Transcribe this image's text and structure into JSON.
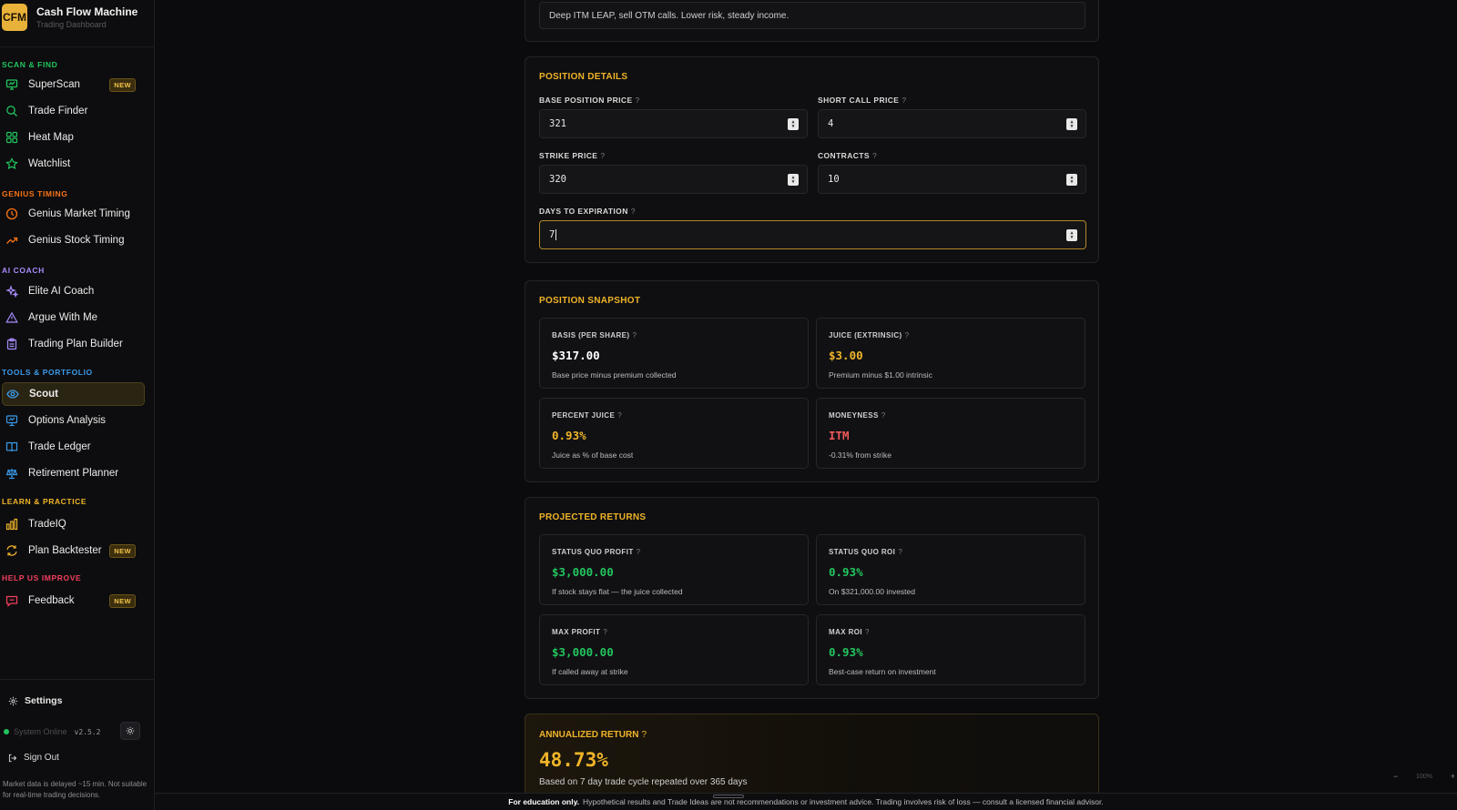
{
  "app": {
    "logo_text": "CFM",
    "title": "Cash Flow Machine",
    "subtitle": "Trading Dashboard"
  },
  "sidebar": {
    "sections": [
      {
        "label": "SCAN & FIND",
        "color": "#22c55e"
      },
      {
        "label": "GENIUS TIMING",
        "color": "#f97316"
      },
      {
        "label": "AI COACH",
        "color": "#a78bfa"
      },
      {
        "label": "TOOLS & PORTFOLIO",
        "color": "#3b9ae8"
      },
      {
        "label": "LEARN & PRACTICE",
        "color": "#f0b429"
      },
      {
        "label": "HELP US IMPROVE",
        "color": "#f43f5e"
      }
    ],
    "items": [
      {
        "label": "SuperScan",
        "icon": "monitor-icon",
        "badge": "NEW"
      },
      {
        "label": "Trade Finder",
        "icon": "search-icon"
      },
      {
        "label": "Heat Map",
        "icon": "grid-icon"
      },
      {
        "label": "Watchlist",
        "icon": "star-icon"
      },
      {
        "label": "Genius Market Timing",
        "icon": "clock-icon"
      },
      {
        "label": "Genius Stock Timing",
        "icon": "trend-up-icon"
      },
      {
        "label": "Elite AI Coach",
        "icon": "sparkles-icon"
      },
      {
        "label": "Argue With Me",
        "icon": "warning-icon"
      },
      {
        "label": "Trading Plan Builder",
        "icon": "clipboard-icon"
      },
      {
        "label": "Scout",
        "icon": "eye-icon",
        "active": true
      },
      {
        "label": "Options Analysis",
        "icon": "presentation-icon"
      },
      {
        "label": "Trade Ledger",
        "icon": "book-icon"
      },
      {
        "label": "Retirement Planner",
        "icon": "scale-icon"
      },
      {
        "label": "TradeIQ",
        "icon": "bar-chart-icon"
      },
      {
        "label": "Plan Backtester",
        "icon": "refresh-icon",
        "badge": "NEW"
      },
      {
        "label": "Feedback",
        "icon": "message-icon",
        "badge": "NEW"
      }
    ],
    "settings_label": "Settings",
    "status_text": "System Online",
    "version": "v2.5.2",
    "signout_label": "Sign Out",
    "disclaimer": "Market data is delayed ~15 min. Not suitable for real-time trading decisions."
  },
  "strategy": {
    "description": "Deep ITM LEAP, sell OTM calls. Lower risk, steady income."
  },
  "position_details": {
    "title": "POSITION DETAILS",
    "base_price": {
      "label": "BASE POSITION PRICE",
      "value": "321"
    },
    "short_call": {
      "label": "SHORT CALL PRICE",
      "value": "4"
    },
    "strike": {
      "label": "STRIKE PRICE",
      "value": "320"
    },
    "contracts": {
      "label": "CONTRACTS",
      "value": "10"
    },
    "dte": {
      "label": "DAYS TO EXPIRATION",
      "value": "7"
    }
  },
  "snapshot": {
    "title": "POSITION SNAPSHOT",
    "basis": {
      "label": "BASIS (PER SHARE)",
      "value": "$317.00",
      "desc": "Base price minus premium collected"
    },
    "juice": {
      "label": "JUICE (EXTRINSIC)",
      "value": "$3.00",
      "desc": "Premium minus $1.00 intrinsic"
    },
    "pct_juice": {
      "label": "PERCENT JUICE",
      "value": "0.93%",
      "desc": "Juice as % of base cost"
    },
    "moneyness": {
      "label": "MONEYNESS",
      "value": "ITM",
      "desc": "-0.31% from strike"
    }
  },
  "returns": {
    "title": "PROJECTED RETURNS",
    "sq_profit": {
      "label": "STATUS QUO PROFIT",
      "value": "$3,000.00",
      "desc": "If stock stays flat — the juice collected"
    },
    "sq_roi": {
      "label": "STATUS QUO ROI",
      "value": "0.93%",
      "desc": "On $321,000.00 invested"
    },
    "max_profit": {
      "label": "MAX PROFIT",
      "value": "$3,000.00",
      "desc": "If called away at strike"
    },
    "max_roi": {
      "label": "MAX ROI",
      "value": "0.93%",
      "desc": "Best-case return on investment"
    }
  },
  "annualized": {
    "title": "ANNUALIZED RETURN",
    "value": "48.73%",
    "desc": "Based on 7 day trade cycle repeated over 365 days"
  },
  "footer": {
    "bold": "For education only.",
    "text": "Hypothetical results and Trade Ideas are not recommendations or investment advice. Trading involves risk of loss — consult a licensed financial advisor."
  },
  "zoom": {
    "minus": "−",
    "value": "100%",
    "plus": "+"
  },
  "help_glyph": "?",
  "colors": {
    "accent": "#f0b429",
    "green": "#22c55e",
    "red": "#f05a5a",
    "surface": "#0f0f11"
  }
}
